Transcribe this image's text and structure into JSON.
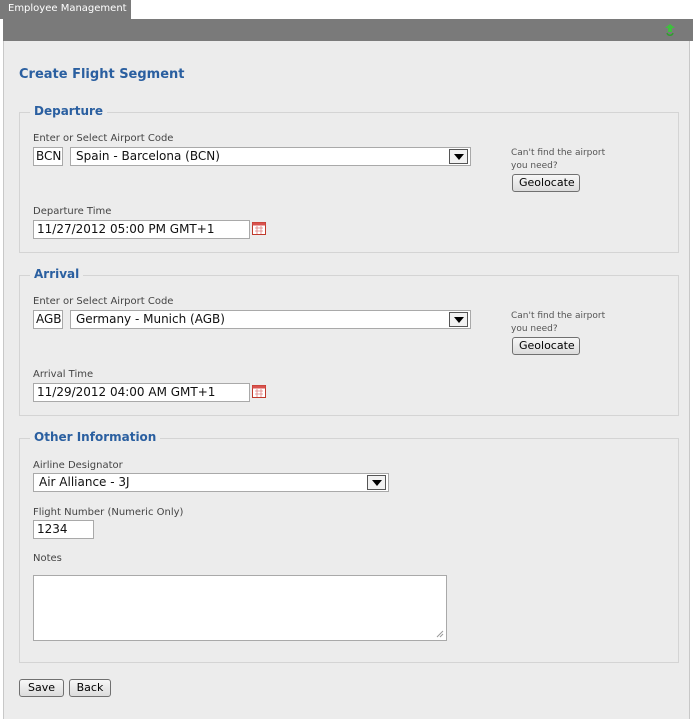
{
  "tab": {
    "label": "Employee Management"
  },
  "page": {
    "title": "Create Flight Segment"
  },
  "departure": {
    "legend": "Departure",
    "airport_label": "Enter or Select Airport Code",
    "airport_code": "BCN",
    "airport_selected": "Spain - Barcelona (BCN)",
    "hint": "Can't find the airport you need?",
    "geolocate_label": "Geolocate",
    "time_label": "Departure Time",
    "time_value": "11/27/2012 05:00 PM GMT+1"
  },
  "arrival": {
    "legend": "Arrival",
    "airport_label": "Enter or Select Airport Code",
    "airport_code": "AGB",
    "airport_selected": "Germany - Munich (AGB)",
    "hint": "Can't find the airport you need?",
    "geolocate_label": "Geolocate",
    "time_label": "Arrival Time",
    "time_value": "11/29/2012 04:00 AM GMT+1"
  },
  "other": {
    "legend": "Other Information",
    "airline_label": "Airline Designator",
    "airline_selected": "Air Alliance - 3J",
    "flight_label": "Flight Number (Numeric Only)",
    "flight_value": "1234",
    "notes_label": "Notes",
    "notes_value": ""
  },
  "actions": {
    "save_label": "Save",
    "back_label": "Back"
  },
  "colors": {
    "accent": "#2a5fa0",
    "header_bar": "#7a7a7a",
    "page_bg": "#ececec"
  }
}
